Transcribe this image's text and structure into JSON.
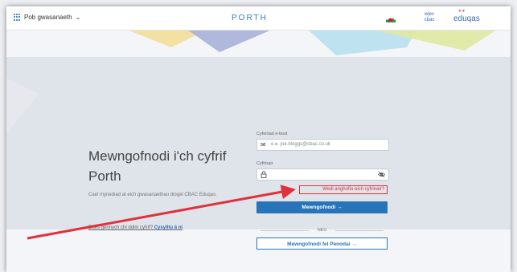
{
  "header": {
    "services_label": "Pob gwasanaeth",
    "brand": "PORTH",
    "cbac_logo_line1": "wjec",
    "cbac_logo_line2": "cbac",
    "eduqas_logo": "eduqas"
  },
  "intro": {
    "title": "Mewngofnodi i'ch cyfrif Porth",
    "subtitle": "Cael mynediad at eich gwasanaethau diogel CBAC Eduqas.",
    "no_account_text": "Does gennych chi ddim cyfrif?",
    "contact_link": "Cysylltu â ni"
  },
  "form": {
    "email_label": "Cyfeiriad e-bost",
    "email_placeholder": "e.e. joe.bloggs@cbac.co.uk",
    "password_label": "Cyfrinair",
    "forgot_link": "Wedi anghofio eich cyfrinair?",
    "login_button": "Mewngofnodi →",
    "or_label": "NEU",
    "examiner_button": "Mewngofnodi fel Penodai →"
  },
  "colors": {
    "accent": "#2874b8",
    "highlight": "#d9363e",
    "brand": "#2f7fc2"
  }
}
